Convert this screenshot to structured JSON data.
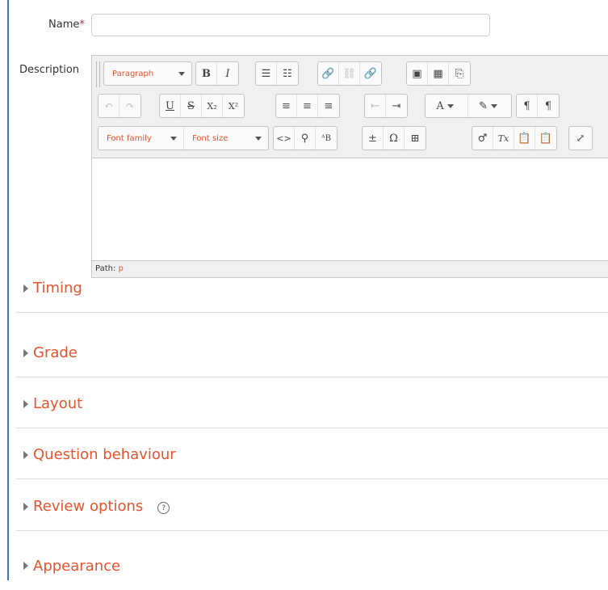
{
  "form": {
    "name_label": "Name",
    "required_mark": "*",
    "name_value": "",
    "description_label": "Description"
  },
  "editor": {
    "block_format": "Paragraph",
    "font_family": "Font family",
    "font_size": "Font size",
    "path_label": "Path:",
    "path_value": "p",
    "glyphs": {
      "bold": "B",
      "italic": "I",
      "bullets": "☰",
      "numbers": "☷",
      "link": "🔗",
      "unlink": "⛓",
      "anchor": "🔗",
      "image": "▣",
      "media": "▦",
      "manage": "⎘",
      "undo": "↶",
      "redo": "↷",
      "underline": "U",
      "strike": "S",
      "subscript": "X₂",
      "superscript": "X²",
      "align_left": "≡",
      "align_center": "≡",
      "align_right": "≡",
      "outdent": "⇤",
      "indent": "⇥",
      "text_color": "A",
      "bg_color": "✎",
      "ltr": "¶",
      "rtl": "¶",
      "code": "<>",
      "search": "⚲",
      "spell": "ᴬB",
      "char_plus": "±",
      "omega": "Ω",
      "table": "⊞",
      "clear_format": "♂",
      "clear_tx": "Tx",
      "paste_text": "📋",
      "paste_word": "📋",
      "fullscreen": "⤢"
    }
  },
  "sections": [
    {
      "title": "Timing"
    },
    {
      "title": "Grade"
    },
    {
      "title": "Layout"
    },
    {
      "title": "Question behaviour"
    },
    {
      "title": "Review options",
      "help": "?"
    },
    {
      "title": "Appearance"
    }
  ],
  "colors": {
    "accent": "#e8522d",
    "border_left": "#3b78c3",
    "required": "#e02020"
  }
}
